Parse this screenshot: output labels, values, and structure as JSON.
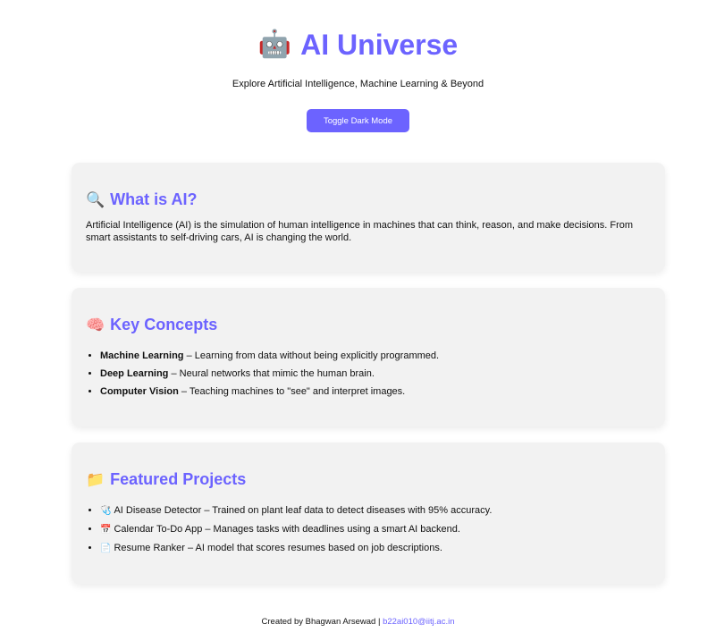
{
  "header": {
    "title_emoji": "🤖",
    "title": "AI Universe",
    "subtitle": "Explore Artificial Intelligence, Machine Learning & Beyond",
    "toggle_label": "Toggle Dark Mode"
  },
  "sections": {
    "what_is_ai": {
      "emoji": "🔍",
      "heading": "What is AI?",
      "body": "Artificial Intelligence (AI) is the simulation of human intelligence in machines that can think, reason, and make decisions. From smart assistants to self-driving cars, AI is changing the world."
    },
    "key_concepts": {
      "emoji": "🧠",
      "heading": "Key Concepts",
      "items": [
        {
          "term": "Machine Learning",
          "desc": " – Learning from data without being explicitly programmed."
        },
        {
          "term": "Deep Learning",
          "desc": " – Neural networks that mimic the human brain."
        },
        {
          "term": "Computer Vision",
          "desc": " – Teaching machines to \"see\" and interpret images."
        }
      ]
    },
    "featured_projects": {
      "emoji": "📁",
      "heading": "Featured Projects",
      "items": [
        {
          "icon": "🩺",
          "text": "AI Disease Detector – Trained on plant leaf data to detect diseases with 95% accuracy."
        },
        {
          "icon": "📅",
          "text": "Calendar To-Do App – Manages tasks with deadlines using a smart AI backend."
        },
        {
          "icon": "📄",
          "text": "Resume Ranker – AI model that scores resumes based on job descriptions."
        }
      ]
    }
  },
  "footer": {
    "credit": "Created by Bhagwan Arsewad | ",
    "email": "b22ai010@iitj.ac.in"
  },
  "colors": {
    "accent": "#6c63ff",
    "card_bg": "#f2f2f2"
  }
}
